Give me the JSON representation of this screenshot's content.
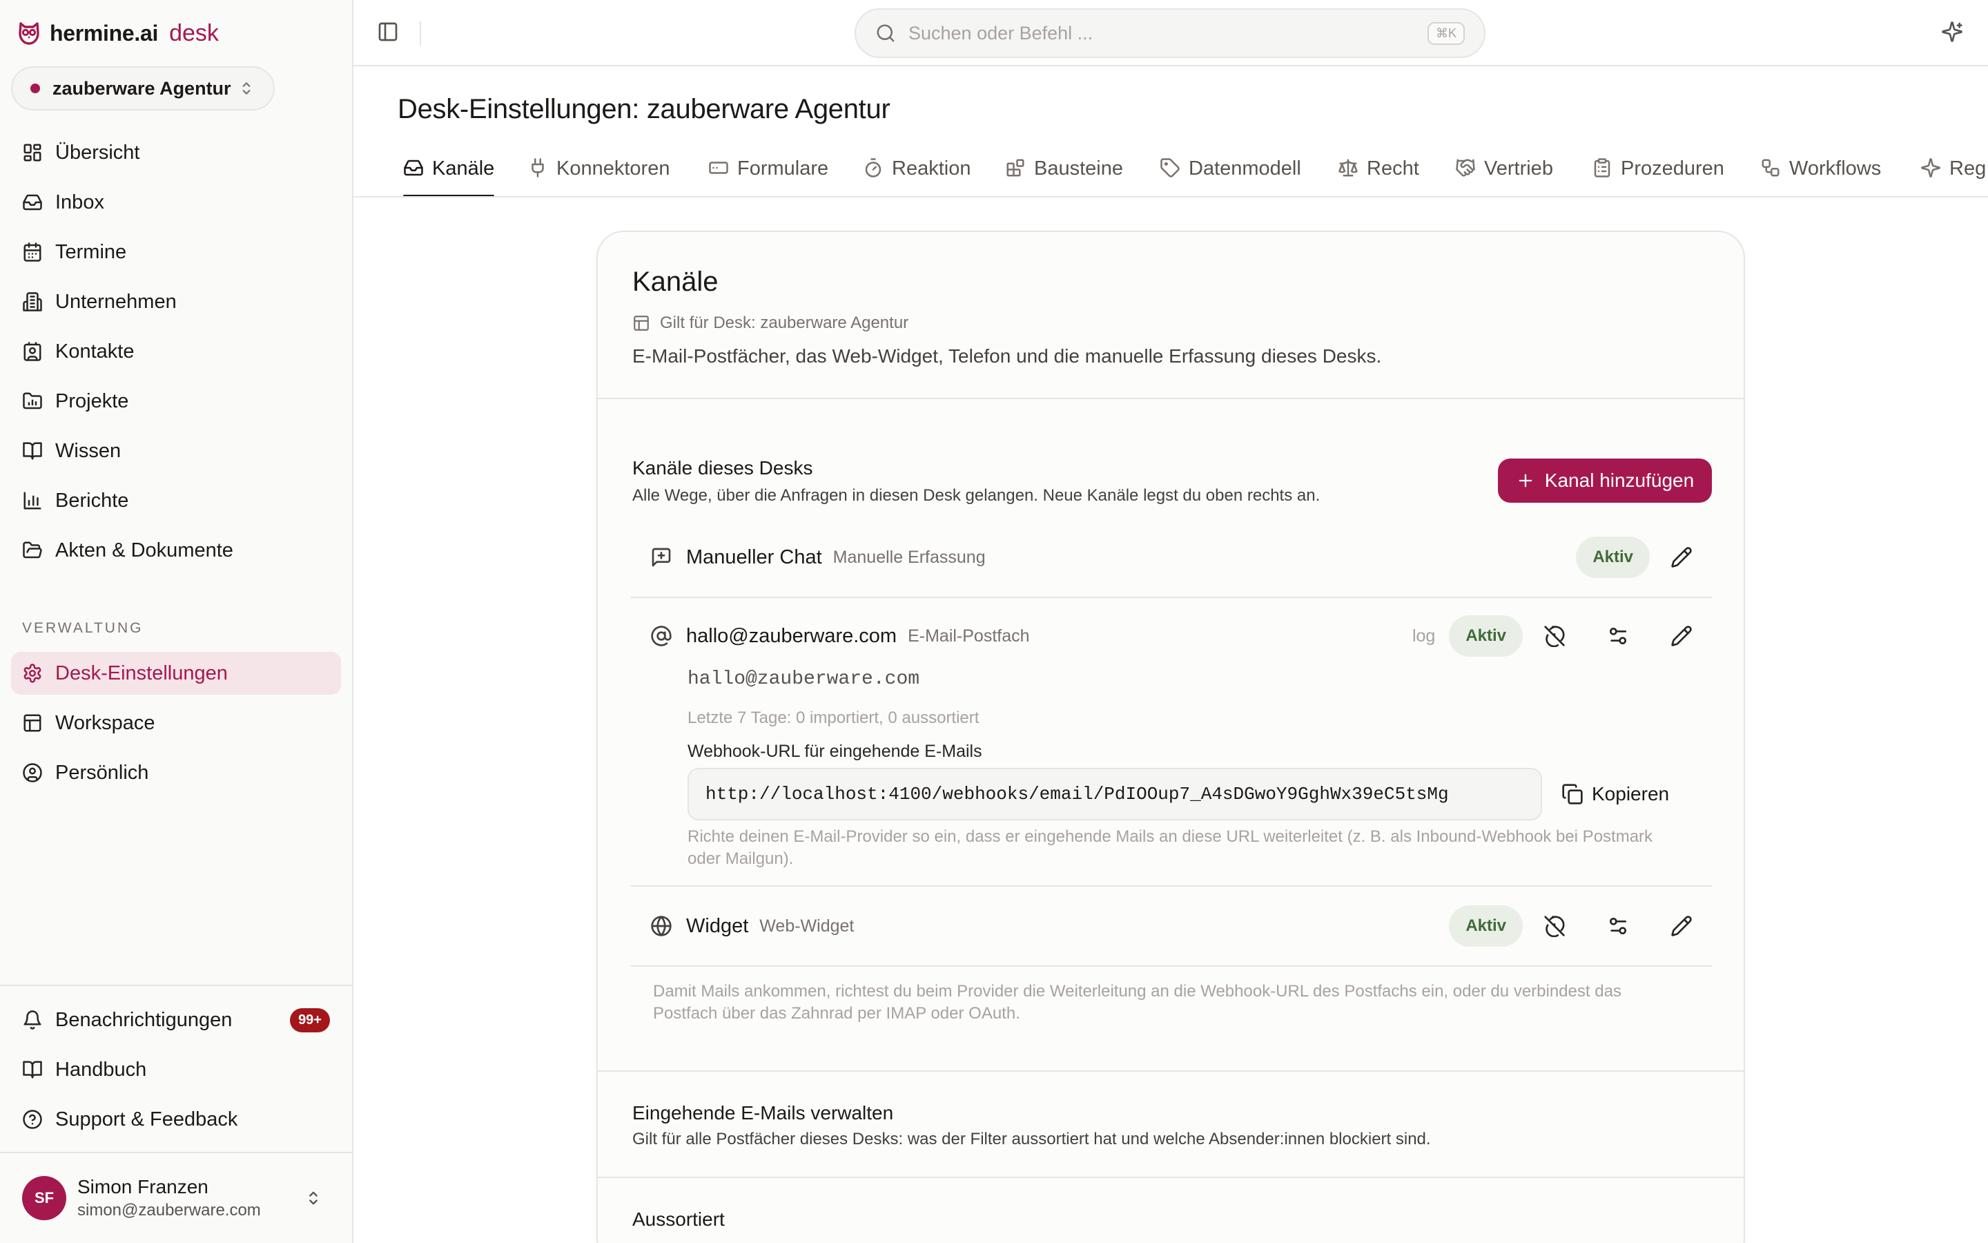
{
  "brand": {
    "name": "hermine.ai",
    "product": "desk"
  },
  "desk_switcher": {
    "label": "zauberware Agentur"
  },
  "sidebar": {
    "items": [
      {
        "label": "Übersicht",
        "icon": "dashboard-icon"
      },
      {
        "label": "Inbox",
        "icon": "inbox-icon"
      },
      {
        "label": "Termine",
        "icon": "calendar-icon"
      },
      {
        "label": "Unternehmen",
        "icon": "building-icon"
      },
      {
        "label": "Kontakte",
        "icon": "contact-icon"
      },
      {
        "label": "Projekte",
        "icon": "folder-chart-icon"
      },
      {
        "label": "Wissen",
        "icon": "book-icon"
      },
      {
        "label": "Berichte",
        "icon": "bar-chart-icon"
      },
      {
        "label": "Akten & Dokumente",
        "icon": "folder-open-icon"
      }
    ],
    "admin_section_label": "VERWALTUNG",
    "admin_items": [
      {
        "label": "Desk-Einstellungen",
        "icon": "gear-icon",
        "active": true
      },
      {
        "label": "Workspace",
        "icon": "layout-icon"
      },
      {
        "label": "Persönlich",
        "icon": "user-circle-icon"
      }
    ],
    "bottom_items": [
      {
        "label": "Benachrichtigungen",
        "icon": "bell-icon",
        "badge": "99+"
      },
      {
        "label": "Handbuch",
        "icon": "book-icon"
      },
      {
        "label": "Support & Feedback",
        "icon": "help-circle-icon"
      }
    ],
    "user": {
      "initials": "SF",
      "name": "Simon Franzen",
      "email": "simon@zauberware.com"
    }
  },
  "search": {
    "placeholder": "Suchen oder Befehl ...",
    "shortcut": "⌘K"
  },
  "page": {
    "title": "Desk-Einstellungen: zauberware Agentur"
  },
  "tabs": [
    {
      "label": "Kanäle",
      "icon": "inbox-icon",
      "active": true
    },
    {
      "label": "Konnektoren",
      "icon": "plug-icon"
    },
    {
      "label": "Formulare",
      "icon": "form-icon"
    },
    {
      "label": "Reaktion",
      "icon": "timer-icon"
    },
    {
      "label": "Bausteine",
      "icon": "blocks-icon"
    },
    {
      "label": "Datenmodell",
      "icon": "tag-icon"
    },
    {
      "label": "Recht",
      "icon": "scale-icon"
    },
    {
      "label": "Vertrieb",
      "icon": "handshake-icon"
    },
    {
      "label": "Prozeduren",
      "icon": "clipboard-icon"
    },
    {
      "label": "Workflows",
      "icon": "workflow-icon"
    },
    {
      "label": "Reg",
      "icon": "sparkles-icon"
    }
  ],
  "card": {
    "title": "Kanäle",
    "scope": "Gilt für Desk: zauberware Agentur",
    "description": "E-Mail-Postfächer, das Web-Widget, Telefon und die manuelle Erfassung dieses Desks.",
    "channels_section": {
      "title": "Kanäle dieses Desks",
      "subtitle": "Alle Wege, über die Anfragen in diesen Desk gelangen. Neue Kanäle legst du oben rechts an.",
      "add_button": "Kanal hinzufügen"
    },
    "channels": [
      {
        "name": "Manueller Chat",
        "type": "Manuelle Erfassung",
        "status": "Aktiv",
        "icon": "message-plus-icon"
      },
      {
        "name": "hallo@zauberware.com",
        "type": "E-Mail-Postfach",
        "status": "Aktiv",
        "log": "log",
        "icon": "at-sign-icon",
        "address": "hallo@zauberware.com",
        "stats": "Letzte 7 Tage: 0 importiert, 0 aussortiert",
        "webhook_label": "Webhook-URL für eingehende E-Mails",
        "webhook_url": "http://localhost:4100/webhooks/email/PdIOOup7_A4sDGwoY9GghWx39eC5tsMg",
        "copy_label": "Kopieren",
        "webhook_help": "Richte deinen E-Mail-Provider so ein, dass er eingehende Mails an diese URL weiterleitet (z. B. als Inbound-Webhook bei Postmark oder Mailgun)."
      },
      {
        "name": "Widget",
        "type": "Web-Widget",
        "status": "Aktiv",
        "icon": "globe-icon"
      }
    ],
    "channels_note": "Damit Mails ankommen, richtest du beim Provider die Weiterleitung an die Webhook-URL des Postfachs ein, oder du verbindest das Postfach über das Zahnrad per IMAP oder OAuth.",
    "incoming_section": {
      "title": "Eingehende E-Mails verwalten",
      "subtitle": "Gilt für alle Postfächer dieses Desks: was der Filter aussortiert hat und welche Absender:innen blockiert sind."
    },
    "sorted_section": {
      "title": "Aussortiert"
    }
  },
  "colors": {
    "brand": "#a5184f",
    "active_bg": "#f5e4e8",
    "status_green_bg": "#e9efe6",
    "status_green_text": "#3f6b3a",
    "badge_red": "#a4161a"
  }
}
